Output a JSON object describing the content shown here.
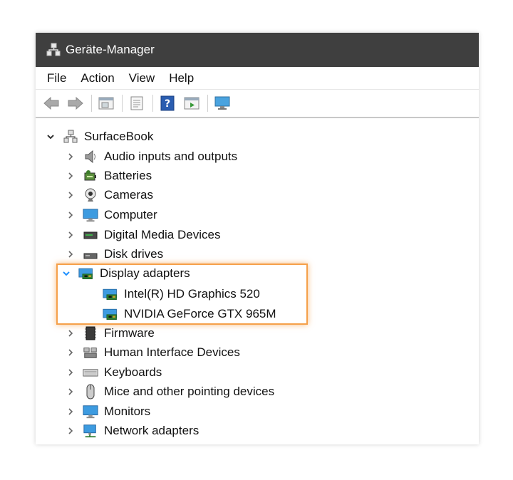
{
  "window": {
    "title": "Geräte-Manager"
  },
  "menu": [
    {
      "label": "File"
    },
    {
      "label": "Action"
    },
    {
      "label": "View"
    },
    {
      "label": "Help"
    }
  ],
  "toolbar": {
    "buttons": [
      "back-arrow-icon",
      "forward-arrow-icon",
      "properties-icon",
      "document-icon",
      "help-icon",
      "play-icon",
      "monitor-icon"
    ]
  },
  "tree": {
    "root": {
      "label": "SurfaceBook",
      "expanded": true,
      "icon": "computer-network-icon"
    },
    "items": [
      {
        "label": "Audio inputs and outputs",
        "icon": "speaker-icon",
        "expanded": false
      },
      {
        "label": "Batteries",
        "icon": "battery-icon",
        "expanded": false
      },
      {
        "label": "Cameras",
        "icon": "camera-icon",
        "expanded": false
      },
      {
        "label": "Computer",
        "icon": "monitor-icon",
        "expanded": false
      },
      {
        "label": "Digital Media Devices",
        "icon": "media-device-icon",
        "expanded": false
      },
      {
        "label": "Disk drives",
        "icon": "disk-icon",
        "expanded": false
      },
      {
        "label": "Display adapters",
        "icon": "display-adapter-icon",
        "expanded": true,
        "children": [
          {
            "label": "Intel(R) HD Graphics 520",
            "icon": "display-adapter-icon"
          },
          {
            "label": "NVIDIA GeForce GTX 965M",
            "icon": "display-adapter-icon"
          }
        ]
      },
      {
        "label": "Firmware",
        "icon": "firmware-icon",
        "expanded": false
      },
      {
        "label": "Human Interface Devices",
        "icon": "hid-icon",
        "expanded": false
      },
      {
        "label": "Keyboards",
        "icon": "keyboard-icon",
        "expanded": false
      },
      {
        "label": "Mice and other pointing devices",
        "icon": "mouse-icon",
        "expanded": false
      },
      {
        "label": "Monitors",
        "icon": "monitor-icon",
        "expanded": false
      },
      {
        "label": "Network adapters",
        "icon": "network-icon",
        "expanded": false
      }
    ]
  },
  "colors": {
    "titlebar": "#3f3f3f",
    "highlight": "#f5a04a",
    "chevron_expanded": "#1e90ff"
  }
}
